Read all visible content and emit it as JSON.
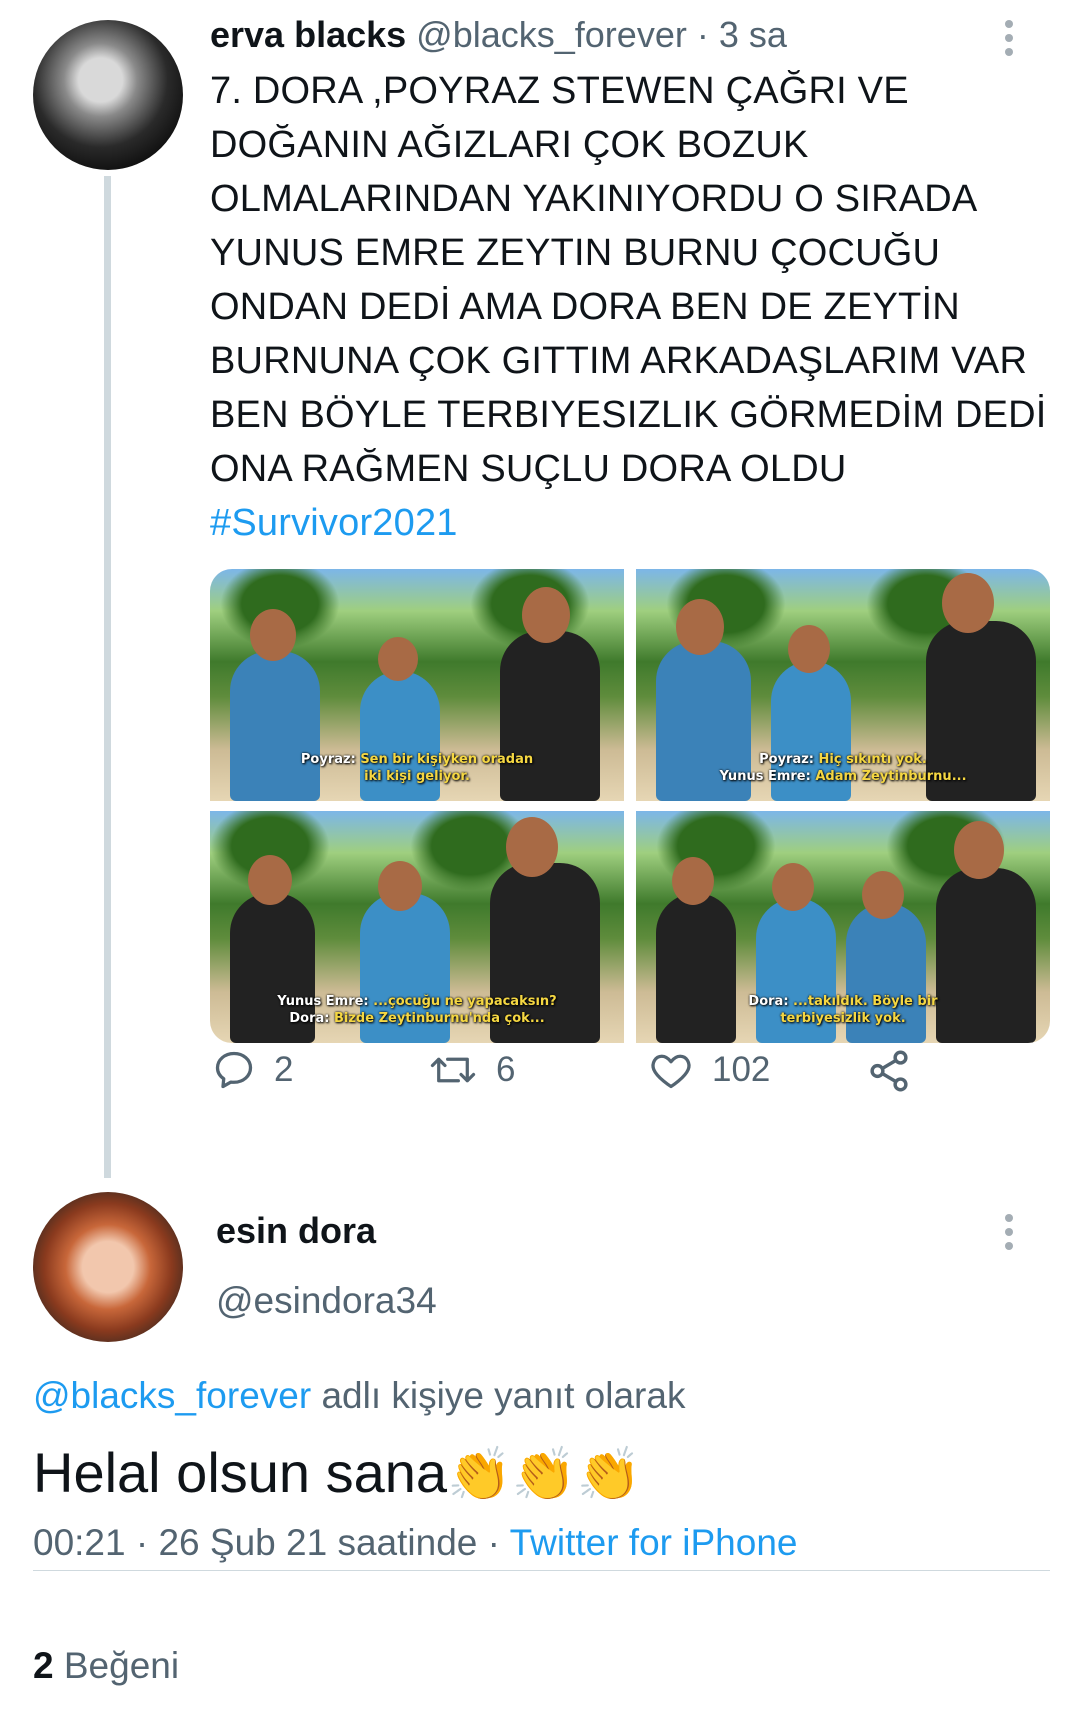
{
  "parent_tweet": {
    "author_name": "erva blacks",
    "handle": "@blacks_forever",
    "separator": "·",
    "time": "3 sa",
    "lines": [
      "7. DORA ,POYRAZ STEWEN ÇAĞRI VE",
      "DOĞANIN AĞIZLARI ÇOK BOZUK",
      "OLMALARINDAN YAKINIYORDU O SIRADA",
      "YUNUS EMRE ZEYTIN BURNU ÇOCUĞU",
      "ONDAN DEDİ AMA DORA BEN DE ZEYTİN",
      "BURNUNA ÇOK GITTIM ARKADAŞLARIM VAR",
      "BEN BÖYLE TERBIYESIZLIK GÖRMEDİM DEDİ",
      "ONA RAĞMEN SUÇLU DORA OLDU"
    ],
    "hashtag": "#Survivor2021",
    "media": [
      {
        "line1_speaker": "Poyraz:",
        "line1_text": " Sen bir kişiyken oradan",
        "line2_speaker": "",
        "line2_text": "iki kişi geliyor."
      },
      {
        "line1_speaker": "Poyraz:",
        "line1_text": " Hiç sıkıntı yok.",
        "line2_speaker": "Yunus Emre:",
        "line2_text": " Adam Zeytinburnu..."
      },
      {
        "line1_speaker": "Yunus Emre:",
        "line1_text": " ...çocuğu ne yapacaksın?",
        "line2_speaker": "Dora:",
        "line2_text": " Bizde Zeytinburnu'nda çok..."
      },
      {
        "line1_speaker": "Dora:",
        "line1_text": " ...takıldık. Böyle bir",
        "line2_speaker": "",
        "line2_text": "terbiyesizlik yok."
      }
    ],
    "actions": {
      "reply_count": "2",
      "retweet_count": "6",
      "like_count": "102"
    }
  },
  "reply_tweet": {
    "author_name": "esin dora",
    "handle": "@esindora34",
    "reply_prefix_mention": "@blacks_forever",
    "reply_prefix_text": " adlı kişiye yanıt olarak",
    "text": "Helal olsun sana",
    "emoji": "👏👏👏",
    "timestamp": "00:21 · 26 Şub 21 saatinde",
    "source_sep": " · ",
    "source": "Twitter for iPhone",
    "likes_count": "2",
    "likes_label": " Beğeni"
  },
  "colors": {
    "link": "#1d9bf0",
    "muted": "#536471",
    "text": "#0f1419",
    "thread_line": "#cfd9de"
  }
}
